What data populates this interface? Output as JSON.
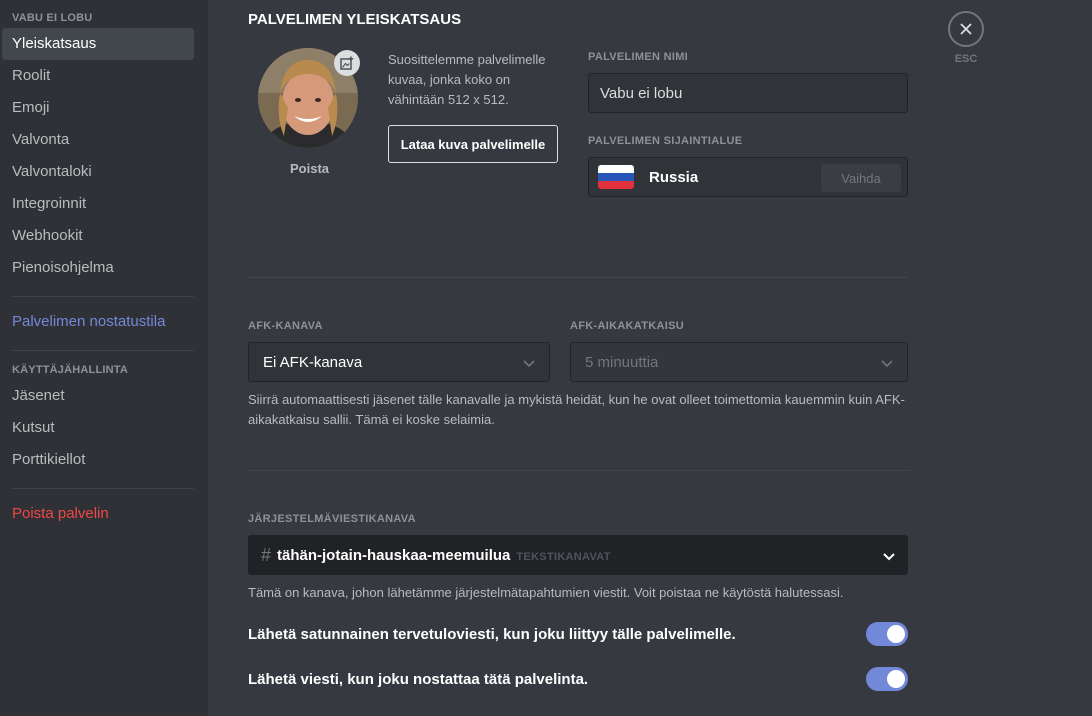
{
  "sidebar": {
    "server_header": "VABU EI LOBU",
    "items": [
      {
        "label": "Yleiskatsaus"
      },
      {
        "label": "Roolit"
      },
      {
        "label": "Emoji"
      },
      {
        "label": "Valvonta"
      },
      {
        "label": "Valvontaloki"
      },
      {
        "label": "Integroinnit"
      },
      {
        "label": "Webhookit"
      },
      {
        "label": "Pienoisohjelma"
      }
    ],
    "boost_label": "Palvelimen nostatustila",
    "user_mgmt_header": "KÄYTTÄJÄHALLINTA",
    "user_items": [
      {
        "label": "Jäsenet"
      },
      {
        "label": "Kutsut"
      },
      {
        "label": "Porttikiellot"
      }
    ],
    "delete_label": "Poista palvelin"
  },
  "main": {
    "title": "PALVELIMEN YLEISKATSAUS",
    "avatar": {
      "remove_label": "Poista"
    },
    "upload_hint": "Suosittelemme palvelimelle kuvaa, jonka koko on vähintään 512 x 512.",
    "upload_button": "Lataa kuva palvelimelle",
    "server_name_label": "PALVELIMEN NIMI",
    "server_name_value": "Vabu ei lobu",
    "region_label": "PALVELIMEN SIJAINTIALUE",
    "region_value": "Russia",
    "region_change": "Vaihda",
    "afk_channel_label": "AFK-KANAVA",
    "afk_channel_value": "Ei AFK-kanava",
    "afk_timeout_label": "AFK-AIKAKATKAISU",
    "afk_timeout_value": "5 minuuttia",
    "afk_help": "Siirrä automaattisesti jäsenet tälle kanavalle ja mykistä heidät, kun he ovat olleet toimettomia kauemmin kuin AFK-aikakatkaisu sallii. Tämä ei koske selaimia.",
    "system_channel_label": "JÄRJESTELMÄVIESTIKANAVA",
    "system_channel_value": "tähän-jotain-hauskaa-meemuilua",
    "system_channel_category": "TEKSTIKANAVAT",
    "system_help": "Tämä on kanava, johon lähetämme järjestelmätapahtumien viestit. Voit poistaa ne käytöstä halutessasi.",
    "toggle_welcome": "Lähetä satunnainen tervetuloviesti, kun joku liittyy tälle palvelimelle.",
    "toggle_boost": "Lähetä viesti, kun joku nostattaa tätä palvelinta.",
    "toggle_welcome_on": true,
    "toggle_boost_on": true,
    "esc_label": "ESC"
  },
  "colors": {
    "accent": "#7289da",
    "danger": "#f04747",
    "background": "#36393f",
    "sidebar": "#2f3136"
  }
}
